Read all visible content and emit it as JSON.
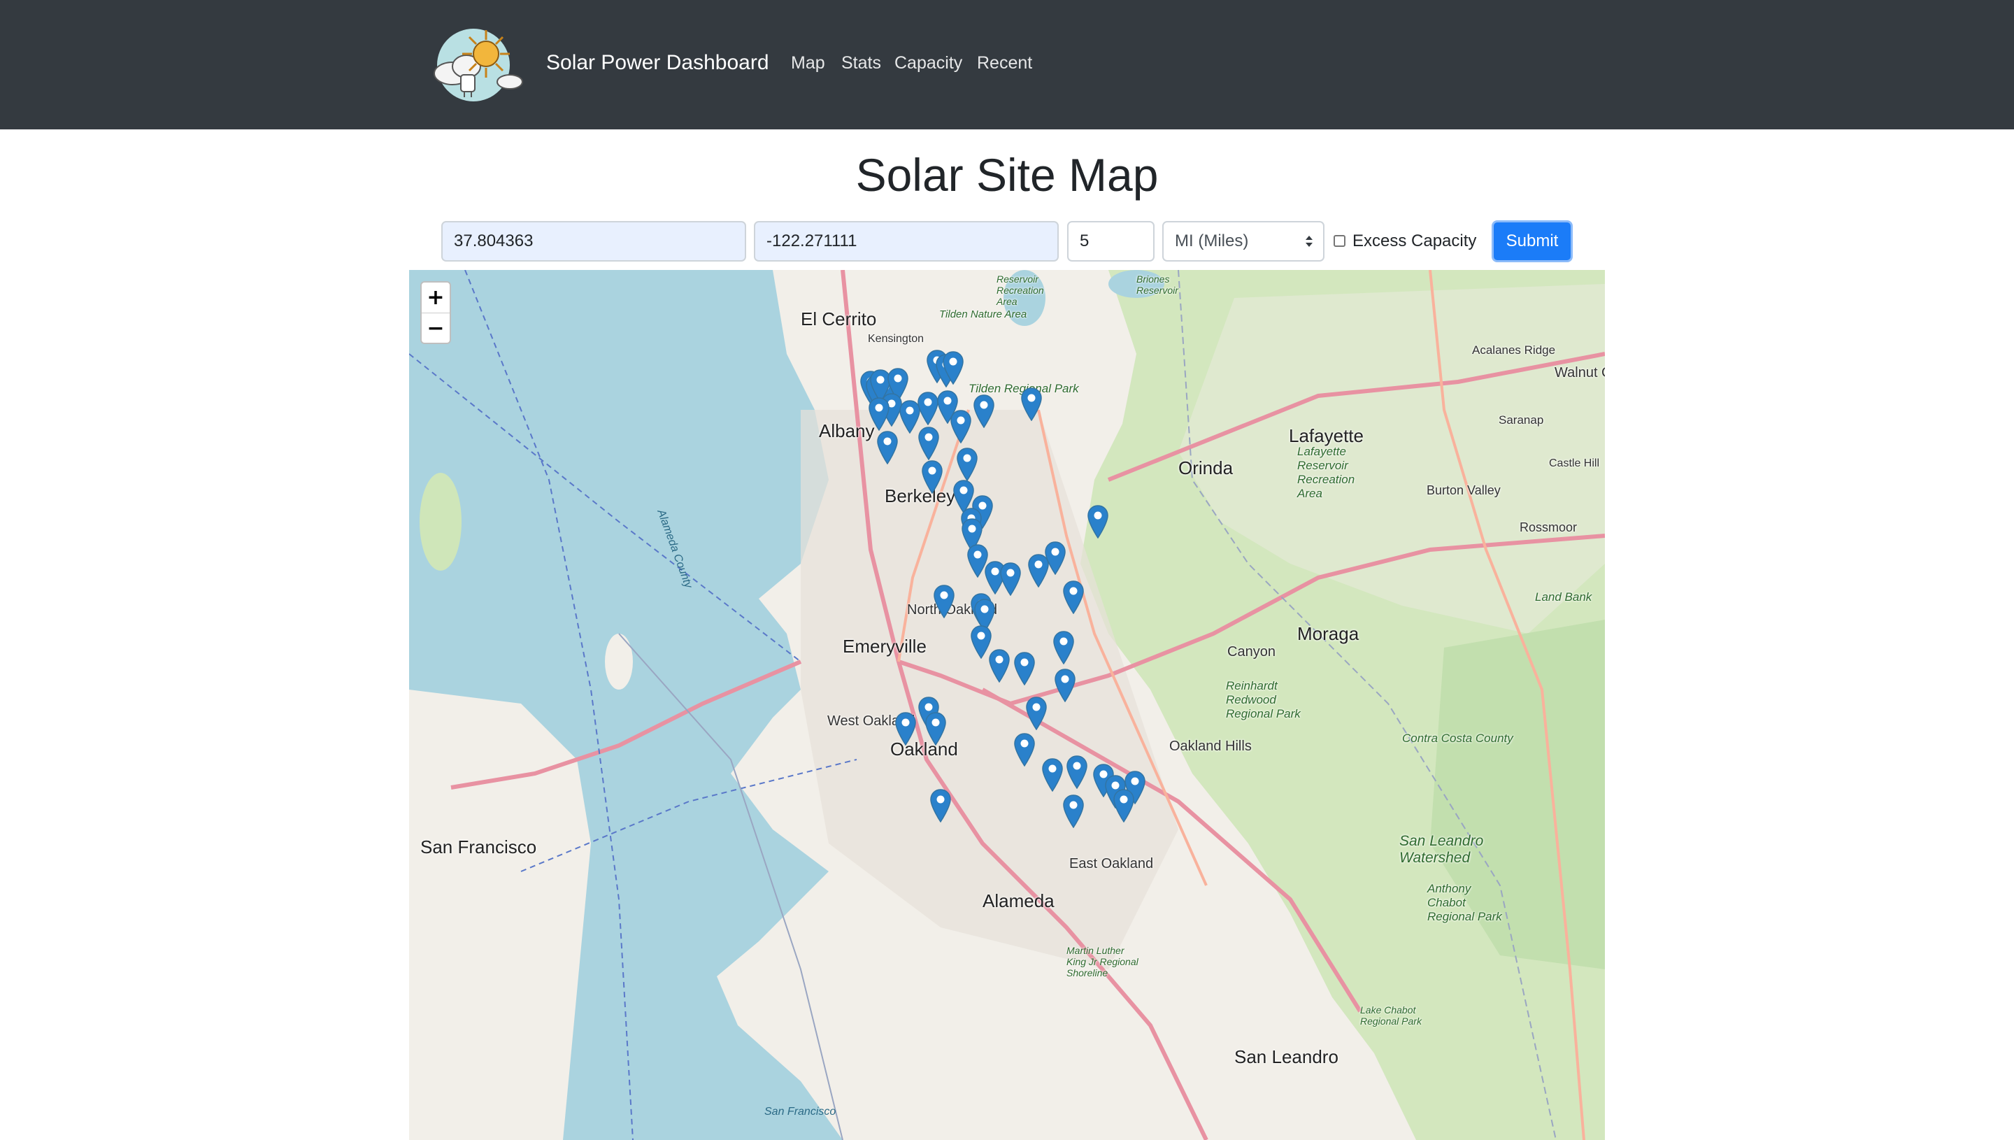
{
  "app": {
    "brand_title": "Solar Power Dashboard",
    "logo_icon": "solar-logo-icon"
  },
  "nav": {
    "links": [
      {
        "label": "Map"
      },
      {
        "label": "Stats"
      },
      {
        "label": "Capacity"
      },
      {
        "label": "Recent"
      }
    ]
  },
  "page": {
    "title": "Solar Site Map"
  },
  "form": {
    "latitude": "37.804363",
    "longitude": "-122.271111",
    "radius": "5",
    "unit_selected": "MI (Miles)",
    "excess_capacity_label": "Excess Capacity",
    "excess_capacity_checked": false,
    "submit_label": "Submit"
  },
  "map": {
    "zoom_in_label": "+",
    "zoom_out_label": "−",
    "marker_icon": "map-pin-icon",
    "marker_color": "#2a81cb",
    "marker_count": 52,
    "place_labels": {
      "el_cerrito": "El Cerrito",
      "kensington": "Kensington",
      "albany": "Albany",
      "berkeley": "Berkeley",
      "north_oakland": "North Oakland",
      "emeryville": "Emeryville",
      "west_oakland": "West Oakland",
      "oakland": "Oakland",
      "alameda": "Alameda",
      "san_francisco": "San Francisco",
      "east_oakland": "East Oakland",
      "san_leandro": "San Leandro",
      "orinda": "Orinda",
      "lafayette": "Lafayette",
      "moraga": "Moraga",
      "canyon": "Canyon",
      "oakland_hills": "Oakland Hills",
      "walnut_creek": "Walnut Creek",
      "acalanes_ridge": "Acalanes Ridge",
      "saranap": "Saranap",
      "burton_valley": "Burton Valley",
      "rossmoor": "Rossmoor",
      "castle_hill": "Castle Hill",
      "tilden_park": "Tilden Regional Park",
      "lafayette_reservoir": "Lafayette Reservoir Recreation Area",
      "reinhardt_park": "Reinhardt Redwood Regional Park",
      "san_leandro_watershed": "San Leandro Watershed",
      "anthony_chabot": "Anthony Chabot Regional Park",
      "contra_costa_county": "Contra Costa County",
      "alameda_county": "Alameda County",
      "san_francisco_water": "San Francisco",
      "land_bank": "Land Bank",
      "mlk_shoreline": "Martin Luther King Jr Regional Shoreline",
      "lake_chabot": "Lake Chabot Regional Park",
      "briones": "Briones Reservoir",
      "san_pablo_reservoir": "Reservoir Recreation Area",
      "tilden_nature_area": "Tilden Nature Area"
    }
  }
}
